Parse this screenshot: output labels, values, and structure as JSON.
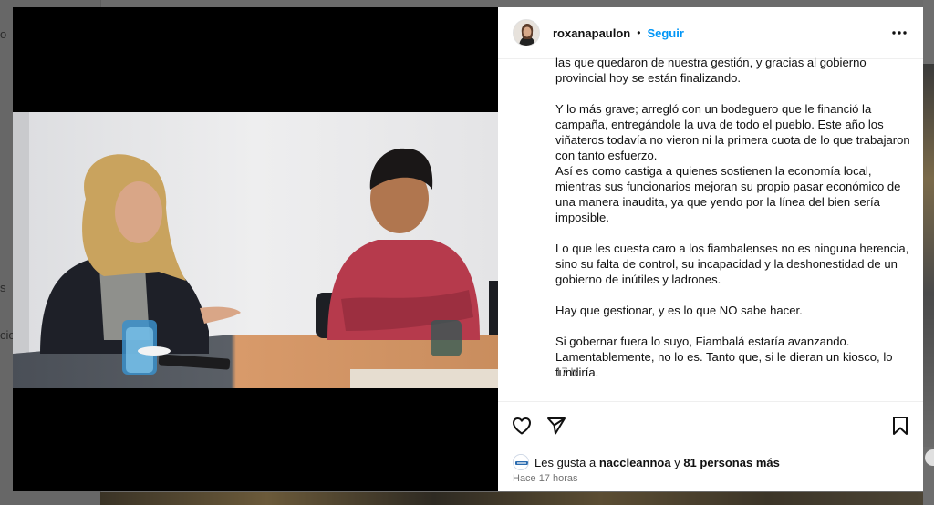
{
  "background": {
    "fragments": [
      "o",
      "s",
      "cio"
    ]
  },
  "post": {
    "username": "roxanapaulon",
    "separator": "•",
    "follow_label": "Seguir",
    "caption": "las que quedaron de nuestra gestión, y gracias al gobierno provincial hoy se están finalizando.\n\nY lo más grave; arregló con un bodeguero que le financió la campaña, entregándole la uva de todo el pueblo. Este año los viñateros todavía no vieron ni la primera cuota de lo que trabajaron con tanto esfuerzo.\nAsí es como castiga a quienes sostienen la economía local, mientras sus funcionarios mejoran su propio pasar económico de una manera inaudita, ya que yendo por la línea del bien sería imposible.\n\nLo que les cuesta caro a los fiambalenses no es ninguna herencia, sino su falta de control, su incapacidad y la deshonestidad de un gobierno de inútiles y ladrones.\n\nHay que gestionar, y es lo que NO sabe hacer.\n\nSi gobernar fuera lo suyo, Fiambalá estaría avanzando. Lamentablemente, no lo es. Tanto que, si le dieran un kiosco, lo fundiría.",
    "timestamp": "17 h",
    "likes_prefix": "Les gusta a ",
    "likes_user": "naccleannoa",
    "likes_mid": " y ",
    "likes_count": "81 personas más",
    "time_ago": "Hace 17 horas"
  },
  "icons": {
    "more": "more-horizontal-icon",
    "like": "heart-icon",
    "share": "send-icon",
    "save": "bookmark-icon"
  },
  "colors": {
    "follow": "#0095f6",
    "muted": "#737373"
  }
}
